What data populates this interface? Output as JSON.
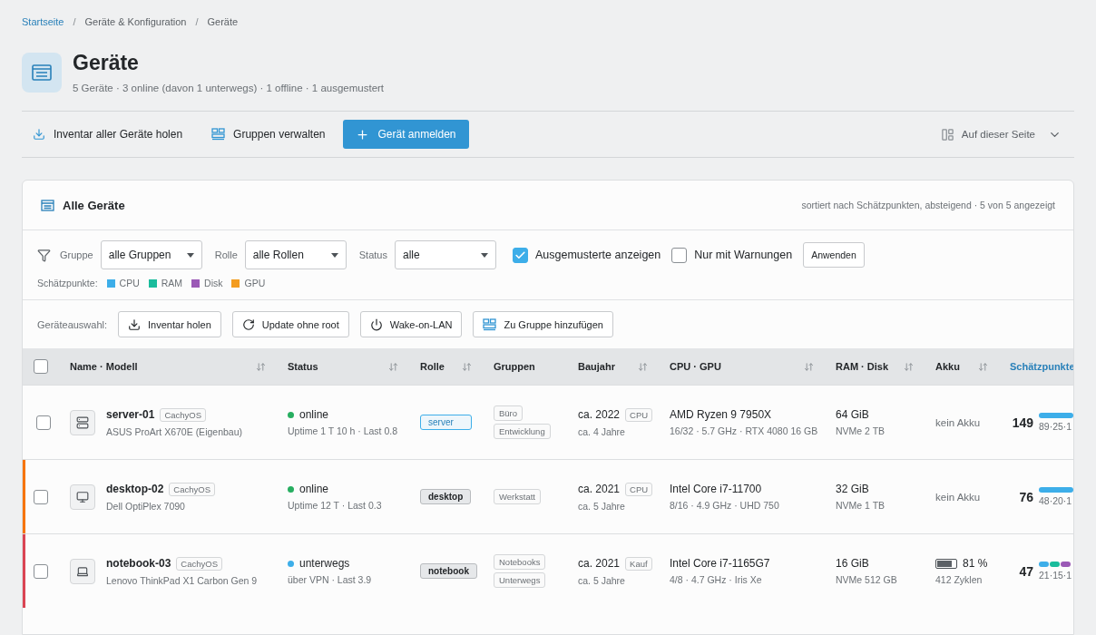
{
  "breadcrumb": {
    "separator": "/",
    "items": [
      {
        "label": "Startseite",
        "link": true
      },
      {
        "label": "Geräte & Konfiguration",
        "link": false
      },
      {
        "label": "Geräte",
        "link": false
      }
    ]
  },
  "page": {
    "title": "Geräte",
    "summary": "5 Geräte · 3 online (davon 1 unterwegs) · 1 offline · 1 ausgemustert"
  },
  "toolbar": {
    "actions": [
      {
        "label": "Inventar aller Geräte holen",
        "kind": "download"
      },
      {
        "label": "Gruppen verwalten",
        "kind": "groups"
      },
      {
        "label": "Gerät anmelden",
        "kind": "primary"
      }
    ],
    "view_menu": "Auf dieser Seite"
  },
  "card": {
    "title": "Alle Geräte",
    "sort_note": "sortiert nach Schätzpunkten, absteigend · 5 von 5 angezeigt"
  },
  "filters": {
    "selects": [
      {
        "label": "Gruppe",
        "value": "alle Gruppen"
      },
      {
        "label": "Rolle",
        "value": "alle Rollen"
      },
      {
        "label": "Status",
        "value": "alle"
      }
    ],
    "checks": [
      {
        "label": "Ausgemusterte anzeigen",
        "checked": true
      },
      {
        "label": "Nur mit Warnungen",
        "checked": false
      }
    ],
    "apply": "Anwenden",
    "legend_label": "Schätzpunkte:",
    "legend": [
      {
        "label": "CPU",
        "color": "#3daee9"
      },
      {
        "label": "RAM",
        "color": "#1abc9c"
      },
      {
        "label": "Disk",
        "color": "#9b59b6"
      },
      {
        "label": "GPU",
        "color": "#f39c1f"
      }
    ]
  },
  "selection": {
    "label": "Geräteauswahl:",
    "actions": [
      {
        "label": "Inventar holen",
        "kind": "download"
      },
      {
        "label": "Update ohne root",
        "kind": "update"
      },
      {
        "label": "Wake-on-LAN",
        "kind": "power"
      },
      {
        "label": "Zu Gruppe hinzufügen",
        "kind": "groups"
      }
    ]
  },
  "table": {
    "select_all": false,
    "columns": [
      {
        "label": "Name · Modell",
        "sortable": true,
        "active": false
      },
      {
        "label": "Status",
        "sortable": true,
        "active": false
      },
      {
        "label": "Rolle",
        "sortable": true,
        "active": false
      },
      {
        "label": "Gruppen",
        "sortable": false,
        "active": false
      },
      {
        "label": "Baujahr",
        "sortable": true,
        "active": false
      },
      {
        "label": "CPU · GPU",
        "sortable": true,
        "active": false
      },
      {
        "label": "RAM · Disk",
        "sortable": true,
        "active": false
      },
      {
        "label": "Akku",
        "sortable": true,
        "active": false
      },
      {
        "label": "Schätzpunkte",
        "sortable": false,
        "active": true
      }
    ],
    "rows": [
      {
        "checked": false,
        "kind": "server",
        "name": "server-01",
        "os": "CachyOS",
        "model": "ASUS ProArt X670E (Eigenbau)",
        "status": {
          "label": "online",
          "color": "#27ae60"
        },
        "status_detail": "Uptime 1 T 10 h · Last 0.8",
        "role": "server",
        "role_selected": true,
        "groups": [
          "Büro",
          "Entwicklung"
        ],
        "year": "ca. 2022",
        "year_tag": "CPU",
        "age": "ca. 4 Jahre",
        "cpu": "AMD Ryzen 9 7950X",
        "cpu_detail": "16/32 · 5.7 GHz · RTX 4080 16 GB",
        "ram": "64 GiB",
        "disk": "NVMe 2 TB",
        "battery": {
          "kind": "none",
          "text": "kein Akku"
        },
        "score": "149",
        "score_parts": "89·25·1",
        "segments": [
          {
            "color": "#3daee9"
          }
        ]
      },
      {
        "checked": false,
        "color": "#f67400",
        "kind": "desktop",
        "name": "desktop-02",
        "os": "CachyOS",
        "model": "Dell OptiPlex 7090",
        "status": {
          "label": "online",
          "color": "#27ae60"
        },
        "status_detail": "Uptime 12 T · Last 0.3",
        "role": "desktop",
        "role_selected": false,
        "groups": [
          "Werkstatt"
        ],
        "year": "ca. 2021",
        "year_tag": "CPU",
        "age": "ca. 5 Jahre",
        "cpu": "Intel Core i7-11700",
        "cpu_detail": "8/16 · 4.9 GHz · UHD 750",
        "ram": "32 GiB",
        "disk": "NVMe 1 TB",
        "battery": {
          "kind": "none",
          "text": "kein Akku"
        },
        "score": "76",
        "score_parts": "48·20·1",
        "segments": [
          {
            "color": "#3daee9"
          }
        ]
      },
      {
        "checked": false,
        "color": "#da4453",
        "kind": "notebook",
        "name": "notebook-03",
        "os": "CachyOS",
        "model": "Lenovo ThinkPad X1 Carbon Gen 9",
        "status": {
          "label": "unterwegs",
          "color": "#3daee9"
        },
        "status_detail": "über VPN · Last 3.9",
        "role": "notebook",
        "role_selected": false,
        "groups": [
          "Notebooks",
          "Unterwegs"
        ],
        "year": "ca. 2021",
        "year_tag": "Kauf",
        "age": "ca. 5 Jahre",
        "cpu": "Intel Core i7-1165G7",
        "cpu_detail": "4/8 · 4.7 GHz · Iris Xe",
        "ram": "16 GiB",
        "disk": "NVMe 512 GB",
        "battery": {
          "kind": "battery",
          "level": 0.81,
          "reading": "81 %",
          "text": "412 Zyklen"
        },
        "score": "47",
        "score_parts": "21·15·1",
        "segments": [
          {
            "color": "#3daee9"
          },
          {
            "color": "#1abc9c"
          },
          {
            "color": "#9b59b6"
          }
        ]
      }
    ]
  }
}
